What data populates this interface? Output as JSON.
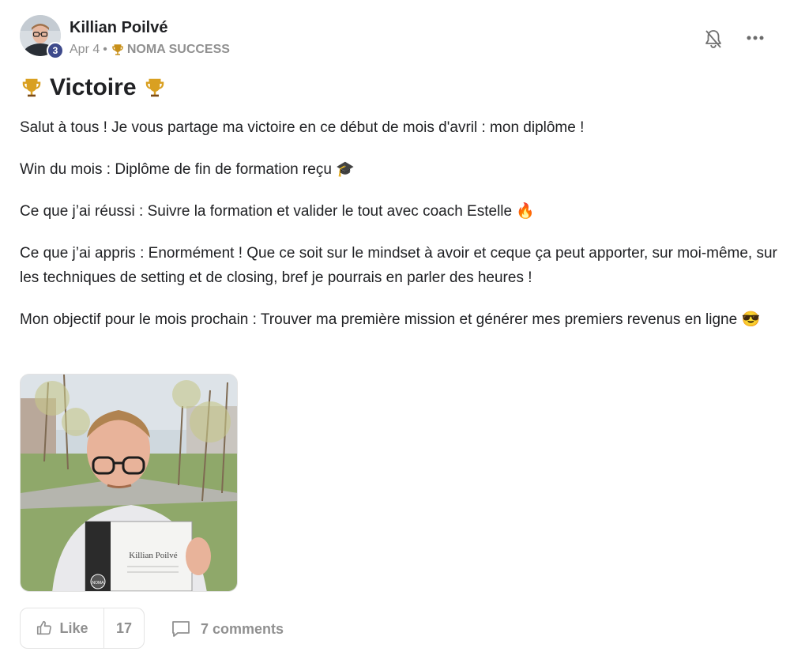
{
  "post": {
    "author": "Killian Poilvé",
    "level": "3",
    "date": "Apr 4",
    "separator": "•",
    "category": "NOMA SUCCESS",
    "title": "Victoire",
    "paragraphs": [
      "Salut à tous ! Je vous partage ma victoire en ce début de mois d'avril : mon diplôme !",
      "Win du mois : Diplôme de fin de formation reçu 🎓",
      "Ce que j’ai réussi : Suivre la formation et valider le tout avec coach Estelle 🔥",
      "Ce que j’ai appris : Enormément ! Que ce soit sur le mindset à avoir et ceque ça peut apporter, sur moi-même, sur les techniques de setting et de closing, bref je pourrais en parler des heures !",
      "Mon objectif pour le mois prochain : Trouver ma première mission et générer mes premiers revenus en ligne 😎"
    ],
    "certificate_text": "Killian Poilvé",
    "certificate_brand": "NOMA"
  },
  "actions": {
    "like_label": "Like",
    "like_count": "17",
    "comments_label": "7 comments"
  },
  "icons": {
    "trophy": "trophy-icon",
    "bell": "bell-icon",
    "more": "more-icon",
    "thumb": "thumbs-up-icon",
    "comment": "comment-icon"
  },
  "colors": {
    "text": "#202124",
    "muted": "#909090",
    "badge": "#3e4a8b",
    "trophy": "#c8901a"
  }
}
